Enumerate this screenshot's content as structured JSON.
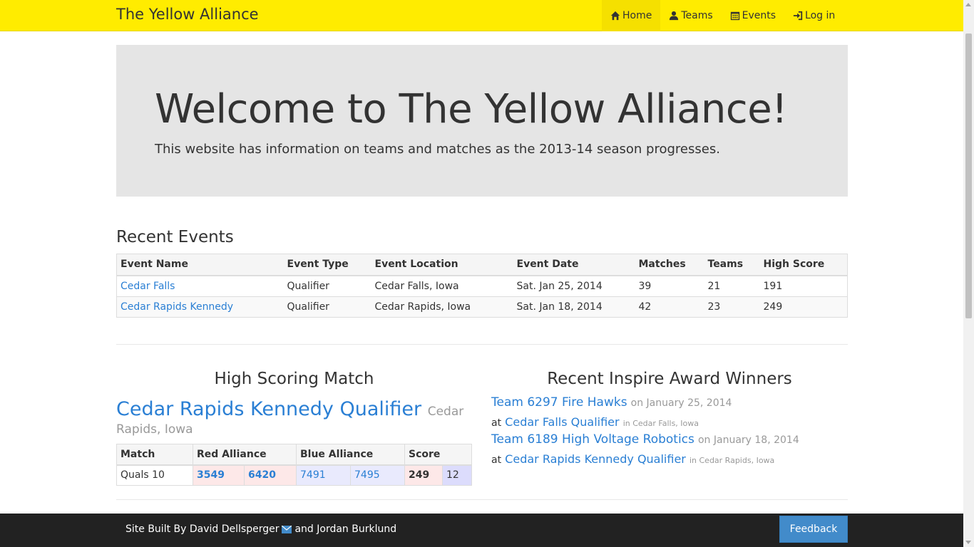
{
  "navbar": {
    "brand": "The Yellow Alliance",
    "items": [
      {
        "label": "Home",
        "icon": "home-icon"
      },
      {
        "label": "Teams",
        "icon": "user-icon"
      },
      {
        "label": "Events",
        "icon": "calendar-icon"
      },
      {
        "label": "Log in",
        "icon": "login-icon"
      }
    ]
  },
  "jumbotron": {
    "title": "Welcome to The Yellow Alliance!",
    "subtitle": "This website has information on teams and matches as the 2013-14 season progresses."
  },
  "recent_events": {
    "title": "Recent Events",
    "columns": [
      "Event Name",
      "Event Type",
      "Event Location",
      "Event Date",
      "Matches",
      "Teams",
      "High Score"
    ],
    "rows": [
      [
        "Cedar Falls",
        "Qualifier",
        "Cedar Falls, Iowa",
        "Sat. Jan 25, 2014",
        "39",
        "21",
        "191"
      ],
      [
        "Cedar Rapids Kennedy",
        "Qualifier",
        "Cedar Rapids, Iowa",
        "Sat. Jan 18, 2014",
        "42",
        "23",
        "249"
      ]
    ]
  },
  "high_scoring": {
    "title": "High Scoring Match",
    "event_name": "Cedar Rapids Kennedy Qualifier",
    "event_location": "Cedar Rapids, Iowa",
    "columns": [
      "Match",
      "Red Alliance",
      "Blue Alliance",
      "Score"
    ],
    "match": {
      "name": "Quals 10",
      "red": [
        "3549",
        "6420"
      ],
      "blue": [
        "7491",
        "7495"
      ],
      "red_score": "249",
      "blue_score": "12"
    }
  },
  "inspire": {
    "title": "Recent Inspire Award Winners",
    "winners": [
      {
        "team": "Team 6297 Fire Hawks",
        "date": "on January 25, 2014",
        "at": "at",
        "event": "Cedar Falls Qualifier",
        "location": "in Cedar Falls, Iowa"
      },
      {
        "team": "Team 6189 High Voltage Robotics",
        "date": "on January 18, 2014",
        "at": "at",
        "event": "Cedar Rapids Kennedy Qualifier",
        "location": "in Cedar Rapids, Iowa"
      }
    ]
  },
  "footer": {
    "built_by": "Site Built By David Dellsperger",
    "and": "and Jordan Burklund",
    "feedback": "Feedback"
  },
  "colors": {
    "navbar": "#ffec00",
    "link": "#2a7fd4",
    "footer": "#222222",
    "feedback_button": "#428bca"
  }
}
